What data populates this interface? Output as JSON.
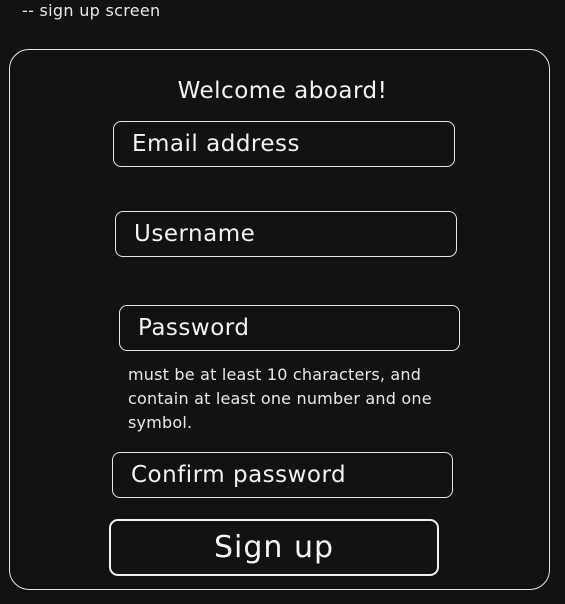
{
  "screen_label": "-- sign up screen",
  "form": {
    "title": "Welcome aboard!",
    "email_placeholder": "Email address",
    "username_placeholder": "Username",
    "password_placeholder": "Password",
    "password_hint": "must be at least 10 characters, and contain at least one number and one symbol.",
    "confirm_password_placeholder": "Confirm password",
    "signup_label": "Sign up"
  }
}
